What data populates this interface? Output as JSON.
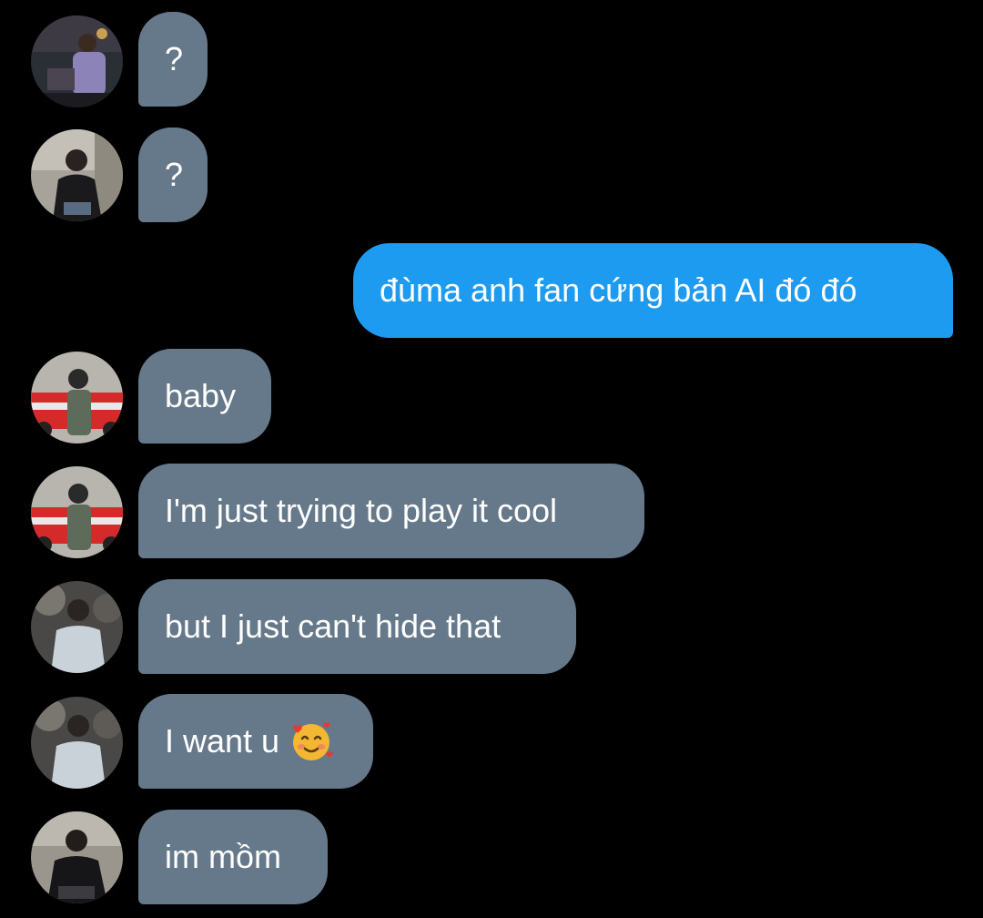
{
  "conversation": {
    "messages": [
      {
        "direction": "incoming",
        "text": "?",
        "avatar": "avatar-purple-jacket"
      },
      {
        "direction": "incoming",
        "text": "?",
        "avatar": "avatar-black-coat"
      },
      {
        "direction": "outgoing",
        "text": "đùma anh fan cứng bản AI đó đó"
      },
      {
        "direction": "incoming",
        "text": "baby",
        "avatar": "avatar-red-car-beanie"
      },
      {
        "direction": "incoming",
        "text": "I'm just trying to play it cool",
        "avatar": "avatar-red-car-beanie"
      },
      {
        "direction": "incoming",
        "text": "but I just can't hide that",
        "avatar": "avatar-grey-hoodie"
      },
      {
        "direction": "incoming",
        "text": "I want u",
        "emoji": "smiling-face-with-hearts-icon",
        "avatar": "avatar-grey-hoodie"
      },
      {
        "direction": "incoming",
        "text": "im mồm",
        "avatar": "avatar-black-coat-sitting"
      }
    ]
  },
  "colors": {
    "background": "#000000",
    "incoming_bubble": "#66798b",
    "outgoing_bubble": "#1d9bf0",
    "text": "#ffffff"
  }
}
